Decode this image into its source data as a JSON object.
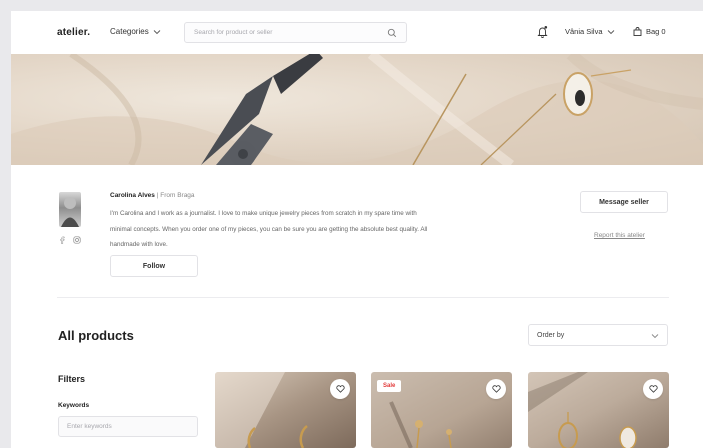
{
  "header": {
    "logo": "atelier.",
    "categories_label": "Categories",
    "search_placeholder": "Search for product or seller",
    "user_name": "Vânia Silva",
    "bag_label": "Bag 0"
  },
  "seller": {
    "name": "Carolina Alves",
    "from": " | From Braga",
    "bio": "I'm Carolina and I work as a journalist. I love to make unique jewelry pieces from scratch in my spare time with minimal concepts. When you order one of my pieces, you can be sure you are getting the absolute best quality. All handmade with love.",
    "follow_label": "Follow",
    "message_label": "Message seller",
    "report_label": "Report this atelier"
  },
  "products": {
    "title": "All products",
    "order_by_label": "Order by",
    "filters_title": "Filters",
    "keywords_label": "Keywords",
    "keywords_placeholder": "Enter keywords",
    "cards": [
      {
        "badge": ""
      },
      {
        "badge": "Sale"
      },
      {
        "badge": ""
      }
    ]
  },
  "colors": {
    "sale": "#e23b3b",
    "banner": "#e4d7c8"
  },
  "icons": [
    "chevron-down-icon",
    "search-icon",
    "bell-icon",
    "bag-icon",
    "facebook-icon",
    "instagram-icon",
    "heart-icon"
  ]
}
